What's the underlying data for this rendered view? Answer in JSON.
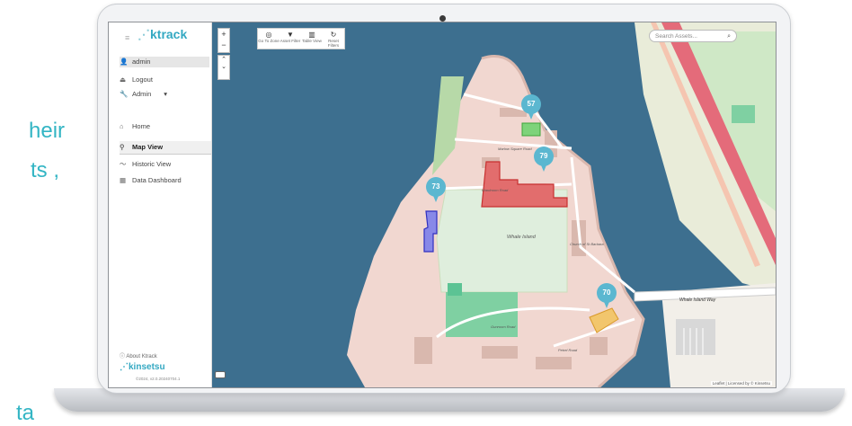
{
  "background_text": {
    "line1": "heir",
    "line2": "ts ,",
    "line3": "ta"
  },
  "app": {
    "logo_text": "ktrack",
    "user": {
      "name": "admin"
    },
    "menu": {
      "logout": "Logout",
      "admin": "Admin",
      "home": "Home",
      "map_view": "Map View",
      "historic_view": "Historic View",
      "data_dashboard": "Data Dashboard"
    },
    "footer": {
      "about": "About Ktrack",
      "brand": "kinsetsu",
      "version": "©2024, v2.0.20240704.1"
    }
  },
  "map": {
    "toolbar": {
      "go_to_zone": "Go To Zone",
      "asset_filter": "Asset Filter",
      "table_view": "Table View",
      "reset_filters": "Reset Filters"
    },
    "search_placeholder": "Search Assets...",
    "zoom_in": "+",
    "zoom_out": "−",
    "island_label": "Whale\nIsland",
    "church_label": "Church\nof St Barbara",
    "road_whale_island_way": "Whale Island Way",
    "road_marlow": "Marlow Square Road",
    "road_wardroom": "Wardroom Road",
    "road_gunroom": "Gunroom Road",
    "road_petrel": "Petrel Road",
    "attribution": "Leaflet | Licensed by © Kinsetsu",
    "markers": [
      {
        "id": "57",
        "color": "#5bb7d0",
        "zone_color": "#7ed37a"
      },
      {
        "id": "79",
        "color": "#5bb7d0",
        "zone_color": "#e24b4b"
      },
      {
        "id": "73",
        "color": "#5bb7d0",
        "zone_color": "#4a4ad8"
      },
      {
        "id": "70",
        "color": "#5bb7d0",
        "zone_color": "#f2b84b"
      }
    ]
  },
  "colors": {
    "accent": "#33b5c4",
    "water": "#3d6f8f",
    "land": "#f1d7d0",
    "green": "#cfe8c6",
    "motorway": "#e46b7a"
  }
}
